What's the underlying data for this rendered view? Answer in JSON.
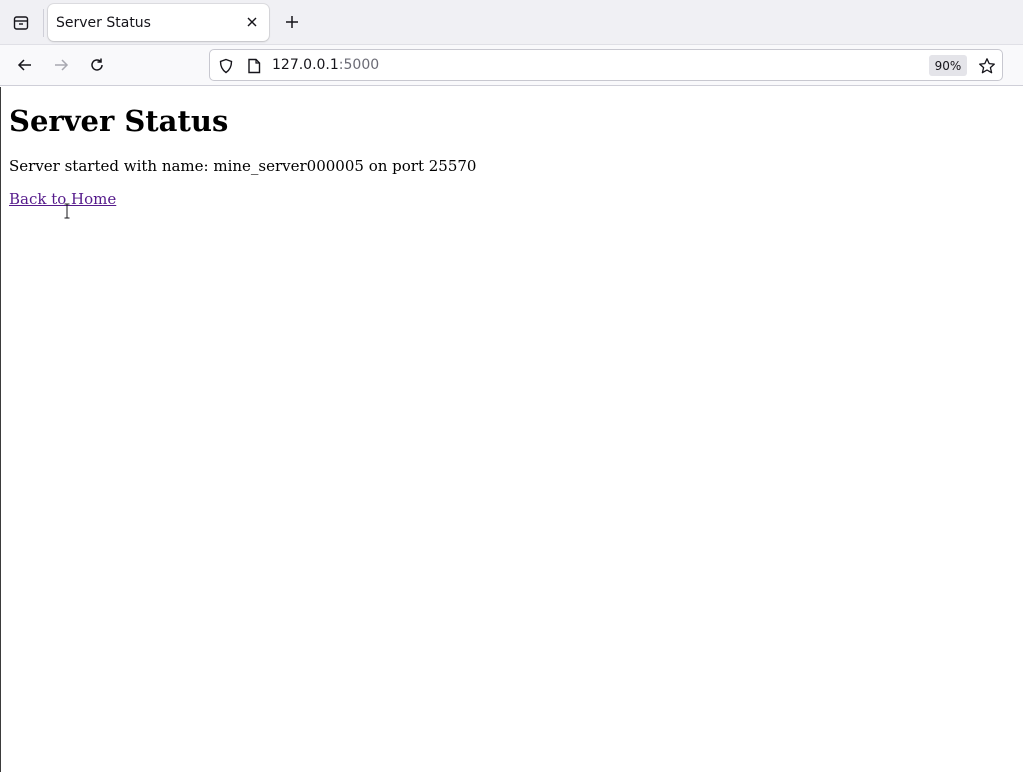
{
  "browser": {
    "tab": {
      "title": "Server Status"
    },
    "url": {
      "host": "127.0.0.1",
      "port": ":5000"
    },
    "zoom": "90%"
  },
  "page": {
    "heading": "Server Status",
    "status_message": "Server started with name: mine_server000005 on port 25570",
    "back_link": "Back to Home"
  }
}
